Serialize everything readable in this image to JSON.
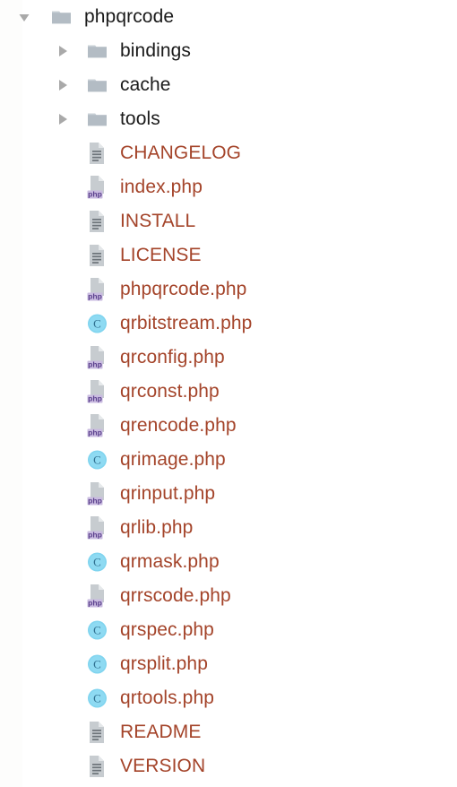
{
  "colors": {
    "file_text": "#a4442a",
    "folder_text": "#1a1a1a",
    "folder_icon": "#b3bcc4",
    "doc_icon": "#c3c8cc",
    "php_badge_bg": "#c9bbe0",
    "php_badge_text": "#5a3f8c",
    "class_circle": "#7fd4ef",
    "class_letter": "#2f6f8f",
    "twisty": "#a9a9a9",
    "background": "#ffffff"
  },
  "tree": {
    "root_label": "phpqrcode",
    "nodes": [
      {
        "label": "phpqrcode",
        "type": "folder",
        "depth": 0,
        "expanded": true,
        "icon": "folder-icon",
        "twisty": "chevron-down-icon"
      },
      {
        "label": "bindings",
        "type": "folder",
        "depth": 1,
        "expanded": false,
        "icon": "folder-icon",
        "twisty": "chevron-right-icon"
      },
      {
        "label": "cache",
        "type": "folder",
        "depth": 1,
        "expanded": false,
        "icon": "folder-icon",
        "twisty": "chevron-right-icon"
      },
      {
        "label": "tools",
        "type": "folder",
        "depth": 1,
        "expanded": false,
        "icon": "folder-icon",
        "twisty": "chevron-right-icon"
      },
      {
        "label": "CHANGELOG",
        "type": "file",
        "depth": 1,
        "icon": "text-document-icon"
      },
      {
        "label": "index.php",
        "type": "file",
        "depth": 1,
        "icon": "php-file-icon",
        "badge": "php"
      },
      {
        "label": "INSTALL",
        "type": "file",
        "depth": 1,
        "icon": "text-document-icon"
      },
      {
        "label": "LICENSE",
        "type": "file",
        "depth": 1,
        "icon": "text-document-icon"
      },
      {
        "label": "phpqrcode.php",
        "type": "file",
        "depth": 1,
        "icon": "php-file-icon",
        "badge": "php"
      },
      {
        "label": "qrbitstream.php",
        "type": "file",
        "depth": 1,
        "icon": "php-class-icon",
        "badge": "C"
      },
      {
        "label": "qrconfig.php",
        "type": "file",
        "depth": 1,
        "icon": "php-file-icon",
        "badge": "php"
      },
      {
        "label": "qrconst.php",
        "type": "file",
        "depth": 1,
        "icon": "php-file-icon",
        "badge": "php"
      },
      {
        "label": "qrencode.php",
        "type": "file",
        "depth": 1,
        "icon": "php-file-icon",
        "badge": "php"
      },
      {
        "label": "qrimage.php",
        "type": "file",
        "depth": 1,
        "icon": "php-class-icon",
        "badge": "C"
      },
      {
        "label": "qrinput.php",
        "type": "file",
        "depth": 1,
        "icon": "php-file-icon",
        "badge": "php"
      },
      {
        "label": "qrlib.php",
        "type": "file",
        "depth": 1,
        "icon": "php-file-icon",
        "badge": "php"
      },
      {
        "label": "qrmask.php",
        "type": "file",
        "depth": 1,
        "icon": "php-class-icon",
        "badge": "C"
      },
      {
        "label": "qrrscode.php",
        "type": "file",
        "depth": 1,
        "icon": "php-file-icon",
        "badge": "php"
      },
      {
        "label": "qrspec.php",
        "type": "file",
        "depth": 1,
        "icon": "php-class-icon",
        "badge": "C"
      },
      {
        "label": "qrsplit.php",
        "type": "file",
        "depth": 1,
        "icon": "php-class-icon",
        "badge": "C"
      },
      {
        "label": "qrtools.php",
        "type": "file",
        "depth": 1,
        "icon": "php-class-icon",
        "badge": "C"
      },
      {
        "label": "README",
        "type": "file",
        "depth": 1,
        "icon": "text-document-icon"
      },
      {
        "label": "VERSION",
        "type": "file",
        "depth": 1,
        "icon": "text-document-icon"
      }
    ]
  }
}
